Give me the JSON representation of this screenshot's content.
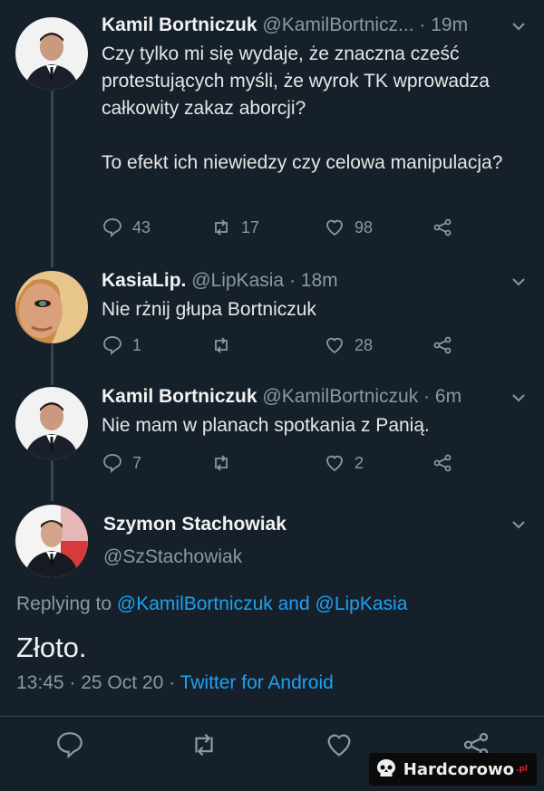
{
  "tweet1": {
    "name": "Kamil Bortniczuk",
    "handle": "@KamilBortnicz...",
    "time": "19m",
    "paragraphs": [
      "Czy tylko mi się wydaje, że znaczna cześć protestujących myśli, że wyrok TK wprowadza całkowity zakaz aborcji?",
      "To efekt ich niewiedzy czy celowa manipulacja?"
    ],
    "replies": "43",
    "retweets": "17",
    "likes": "98"
  },
  "tweet2": {
    "name": "KasiaLip.",
    "handle": "@LipKasia",
    "time": "18m",
    "text": "Nie rżnij głupa Bortniczuk",
    "replies": "1",
    "retweets": "",
    "likes": "28"
  },
  "tweet3": {
    "name": "Kamil Bortniczuk",
    "handle": "@KamilBortniczuk",
    "time": "6m",
    "text": "Nie mam w planach spotkania z Panią.",
    "replies": "7",
    "retweets": "",
    "likes": "2"
  },
  "main": {
    "name": "Szymon Stachowiak",
    "handle": "@SzStachowiak",
    "replying_prefix": "Replying to ",
    "replying_user1": "@KamilBortniczuk",
    "replying_and": " and ",
    "replying_user2": "@LipKasia",
    "text": "Złoto.",
    "datetime": "13:45 · 25 Oct 20 · ",
    "source": "Twitter for Android"
  },
  "watermark": {
    "text": "Hardcorowo",
    "suffix": ".pl"
  },
  "colors": {
    "background": "#15202b",
    "link": "#1da1f2",
    "muted": "#8899a6"
  }
}
